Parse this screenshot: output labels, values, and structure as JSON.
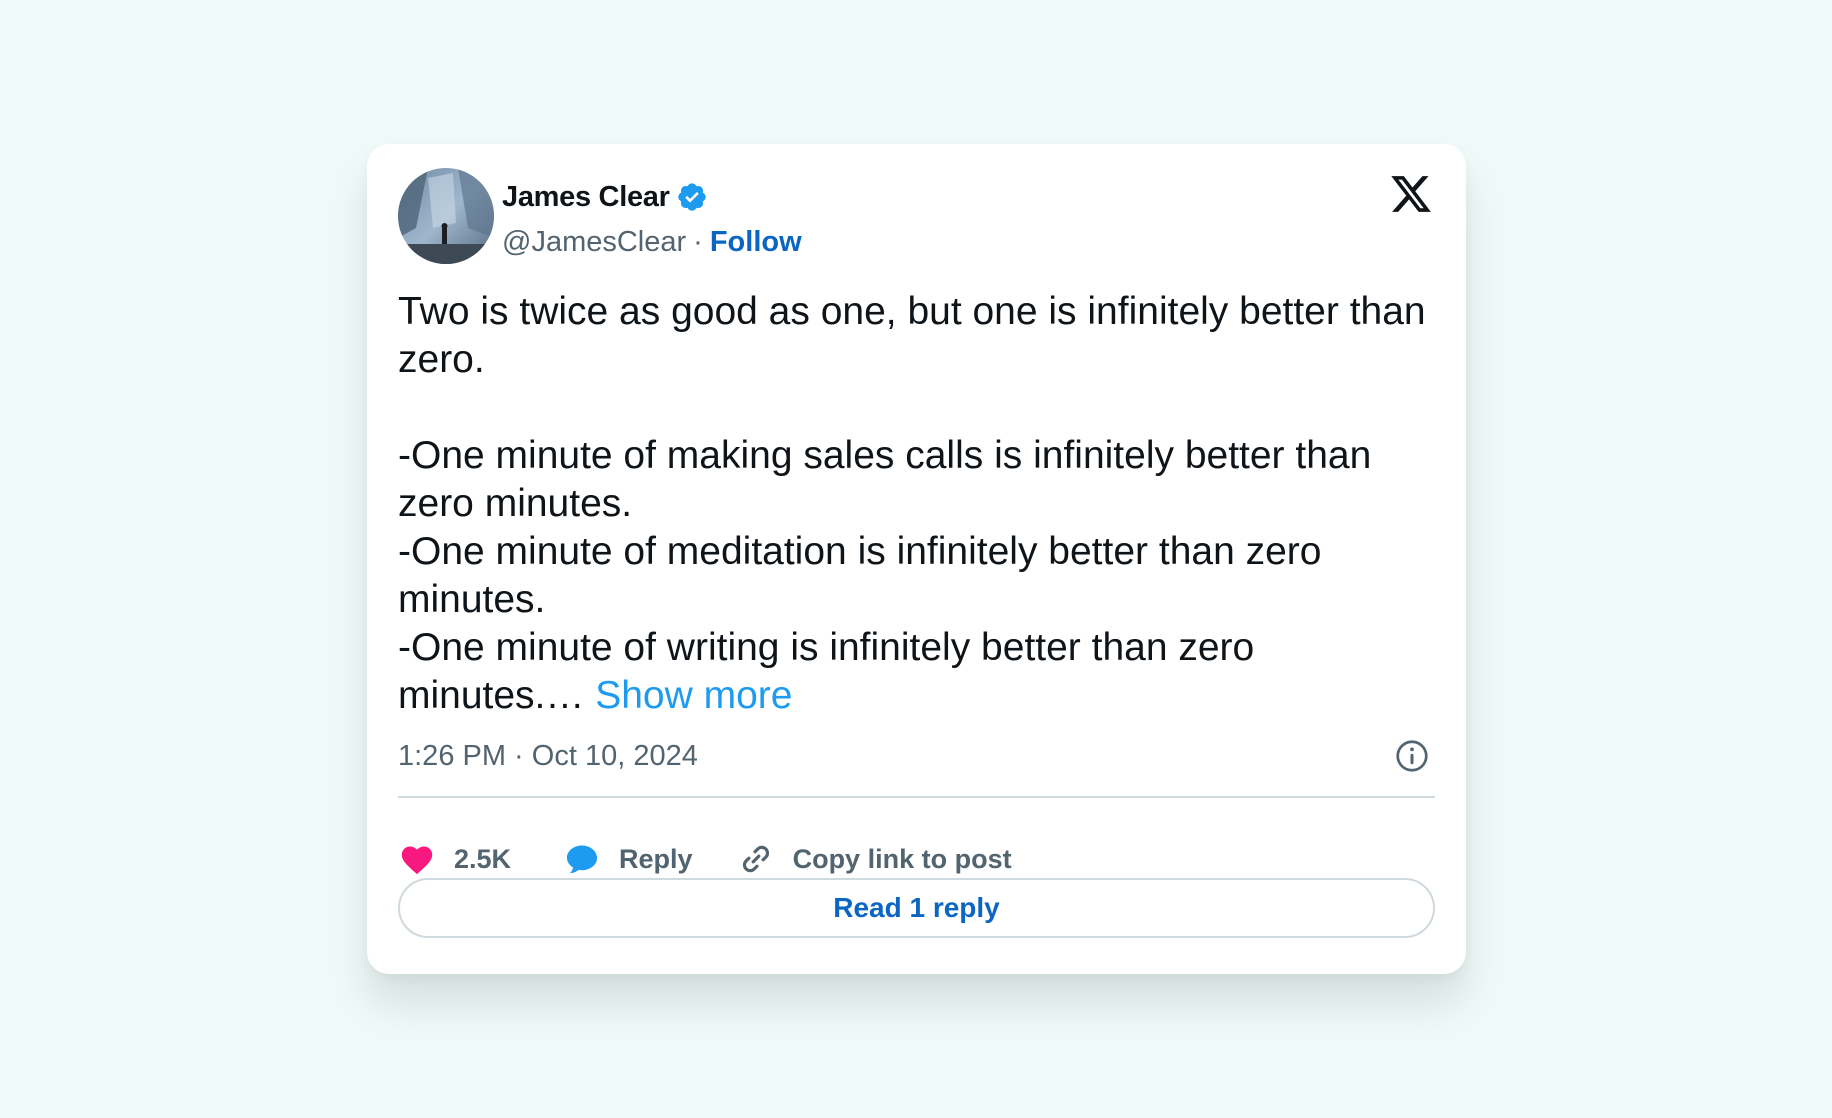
{
  "tweet": {
    "author_name": "James Clear",
    "handle": "@JamesClear",
    "separator": "·",
    "follow_label": "Follow",
    "text_lines": "Two is twice as good as one, but one is infinitely better than zero.\n\n-One minute of making sales calls is infinitely better than zero minutes.\n-One minute of meditation is infinitely better than zero minutes.\n-One minute of writing is infinitely better than zero minutes.… ",
    "show_more_label": "Show more",
    "timestamp": "1:26 PM · Oct 10, 2024"
  },
  "actions": {
    "like_count": "2.5K",
    "reply_label": "Reply",
    "copy_link_label": "Copy link to post"
  },
  "read_reply_label": "Read 1 reply",
  "icons": {
    "verified": "verified-badge-icon",
    "logo": "x-logo-icon",
    "info": "info-icon",
    "like": "heart-icon",
    "reply": "speech-bubble-icon",
    "link": "link-icon"
  },
  "colors": {
    "background": "#effaf8",
    "accent_blue": "#1d9bf0",
    "follow_blue": "#0a66c2",
    "heart_pink": "#f91880",
    "text_primary": "#0f1419",
    "text_secondary": "#536471"
  }
}
